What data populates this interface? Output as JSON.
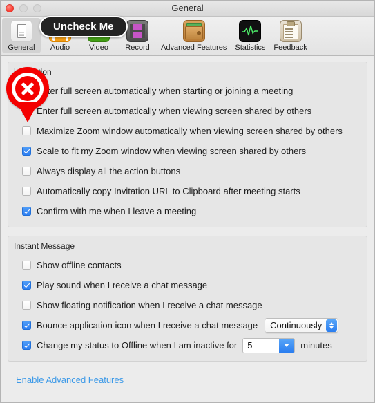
{
  "window": {
    "title": "General",
    "controls": {
      "close": "close",
      "minimize": "minimize",
      "maximize": "maximize"
    }
  },
  "toolbar": {
    "items": [
      {
        "label": "General",
        "icon": "general-icon",
        "selected": true
      },
      {
        "label": "Audio",
        "icon": "audio-icon",
        "selected": false
      },
      {
        "label": "Video",
        "icon": "video-icon",
        "selected": false
      },
      {
        "label": "Record",
        "icon": "record-icon",
        "selected": false
      },
      {
        "label": "Advanced Features",
        "icon": "wallet-icon",
        "selected": false
      },
      {
        "label": "Statistics",
        "icon": "waveform-icon",
        "selected": false
      },
      {
        "label": "Feedback",
        "icon": "clipboard-icon",
        "selected": false
      }
    ]
  },
  "annotation": {
    "bubble_text": "Uncheck Me",
    "marker_icon": "x-mark-pin-icon",
    "marker_color": "#f40000"
  },
  "sections": [
    {
      "title": "Meeting Option",
      "title_obscured_text": "ing Option",
      "rows": [
        {
          "label": "Enter full screen automatically when starting or joining a meeting",
          "checked": false,
          "obscured": true
        },
        {
          "label": "Enter full screen automatically when viewing screen shared by others",
          "checked": false
        },
        {
          "label": "Maximize Zoom window automatically when viewing screen shared by others",
          "checked": false
        },
        {
          "label": "Scale to fit my Zoom window when viewing screen shared by others",
          "checked": true
        },
        {
          "label": "Always display all the action buttons",
          "checked": false
        },
        {
          "label": "Automatically copy Invitation URL to Clipboard after meeting starts",
          "checked": false
        },
        {
          "label": "Confirm with me when I leave a meeting",
          "checked": true
        }
      ]
    },
    {
      "title": "Instant Message",
      "rows": [
        {
          "label": "Show offline contacts",
          "checked": false
        },
        {
          "label": "Play sound when I receive a chat message",
          "checked": true
        },
        {
          "label": "Show floating notification when I receive a chat message",
          "checked": false
        },
        {
          "label": "Bounce application icon when I receive a chat message",
          "checked": true,
          "popup": {
            "value": "Continuously"
          }
        },
        {
          "label": "Change my status to Offline when I am inactive for",
          "checked": true,
          "combo": {
            "value": "5"
          },
          "suffix": "minutes"
        }
      ]
    }
  ],
  "footer": {
    "link_label": "Enable Advanced Features"
  },
  "colors": {
    "accent": "#2d7ff2",
    "link": "#3d9ae8",
    "marker": "#f40000",
    "panel": "#e6e6e6"
  }
}
